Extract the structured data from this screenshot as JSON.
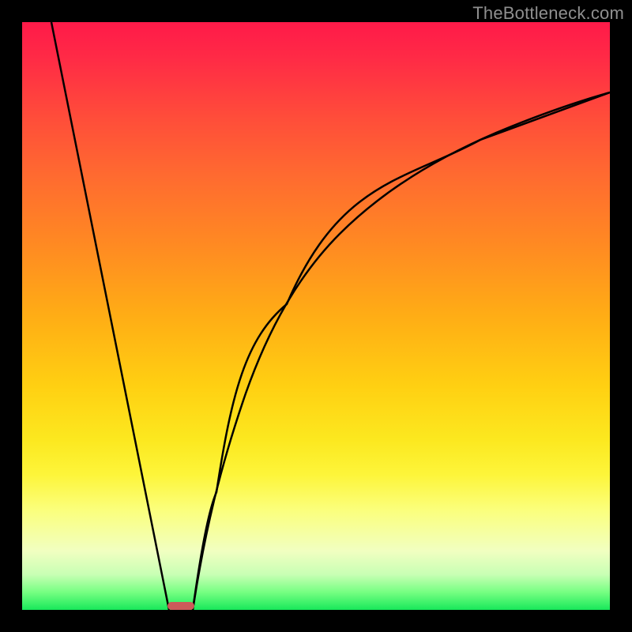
{
  "watermark": "TheBottleneck.com",
  "colors": {
    "frame": "#000000",
    "watermark": "#8f8f8f",
    "curve": "#000000",
    "marker": "#cc5a5a"
  },
  "chart_data": {
    "type": "line",
    "title": "",
    "xlabel": "",
    "ylabel": "",
    "xlim": [
      0,
      100
    ],
    "ylim": [
      0,
      100
    ],
    "grid": false,
    "legend": false,
    "background_gradient": {
      "direction": "top-to-bottom",
      "stops": [
        {
          "pos": 0,
          "color": "#ff1a49"
        },
        {
          "pos": 50,
          "color": "#ffad15"
        },
        {
          "pos": 80,
          "color": "#fdf53a"
        },
        {
          "pos": 100,
          "color": "#18e85a"
        }
      ]
    },
    "series": [
      {
        "name": "left-line",
        "shape": "line-segment",
        "points": [
          {
            "x": 5,
            "y": 100
          },
          {
            "x": 25,
            "y": 0
          }
        ]
      },
      {
        "name": "right-curve",
        "shape": "log-like-ascending",
        "points": [
          {
            "x": 29,
            "y": 0
          },
          {
            "x": 33,
            "y": 20
          },
          {
            "x": 38,
            "y": 37
          },
          {
            "x": 45,
            "y": 52
          },
          {
            "x": 54,
            "y": 64
          },
          {
            "x": 65,
            "y": 73
          },
          {
            "x": 78,
            "y": 80
          },
          {
            "x": 100,
            "y": 88
          }
        ]
      }
    ],
    "marker": {
      "name": "min-marker",
      "x_range": [
        25,
        29
      ],
      "y": 0,
      "height": 1.2
    }
  }
}
